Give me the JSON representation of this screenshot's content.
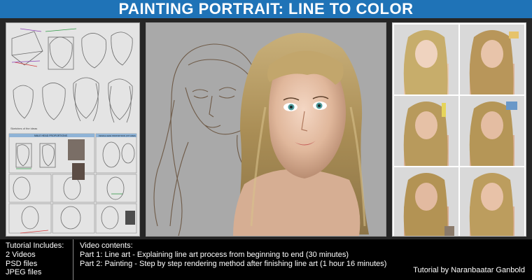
{
  "title": "PAINTING PORTRAIT: LINE TO COLOR",
  "colors": {
    "title_bar": "#1f73b7",
    "background": "#262626",
    "footer": "#000000",
    "text": "#ffffff"
  },
  "footer": {
    "includes_heading": "Tutorial Includes:",
    "includes": [
      "2 Videos",
      "PSD files",
      "JPEG files"
    ],
    "contents_heading": "Video contents:",
    "parts": [
      "Part 1: Line art - Explaining line art process from beginning to end (30 minutes)",
      "Part 2: Painting - Step by step rendering method after finishing line art (1 hour 16 minutes)"
    ],
    "credit": "Tutorial by Naranbaatar Ganbold"
  },
  "left_panel": {
    "labels": [
      "Sketches of the ideas",
      "MALE HEAD PROPORTIONS",
      "FEMALE HEAD PROPORTIONS (STYLIZED)"
    ]
  },
  "icons": [
    "line-art-sheet",
    "portrait-painting",
    "painting-step-thumbnail"
  ]
}
